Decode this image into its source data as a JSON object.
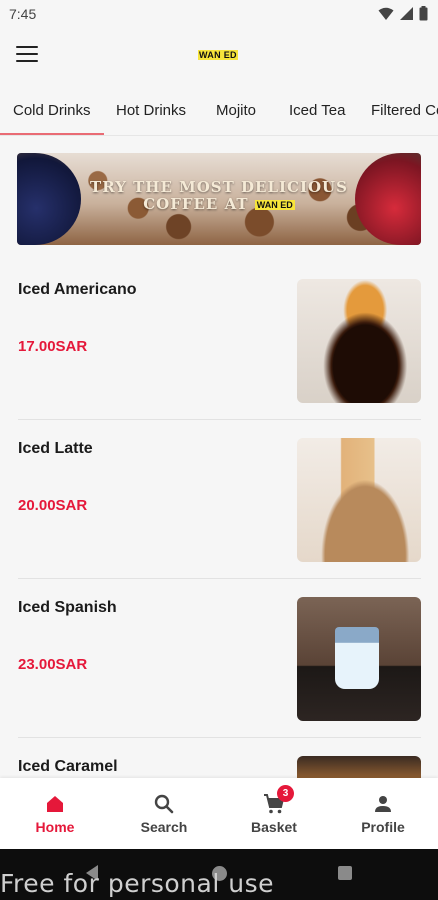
{
  "status": {
    "time": "7:45"
  },
  "header": {
    "logo_text": "WAN ED"
  },
  "tabs": [
    {
      "label": "Cold Drinks",
      "active": true
    },
    {
      "label": "Hot Drinks",
      "active": false
    },
    {
      "label": "Mojito",
      "active": false
    },
    {
      "label": "Iced Tea",
      "active": false
    },
    {
      "label": "Filtered Co",
      "active": false
    }
  ],
  "banner": {
    "line1": "TRY THE MOST DELICIOUS",
    "line2": "COFFEE AT",
    "logo_text": "WAN ED"
  },
  "products": [
    {
      "name": "Iced Americano",
      "price": "17.00SAR"
    },
    {
      "name": "Iced Latte",
      "price": "20.00SAR"
    },
    {
      "name": "Iced Spanish",
      "price": "23.00SAR"
    },
    {
      "name": "Iced Caramel",
      "price": ""
    }
  ],
  "bottom_nav": {
    "home": "Home",
    "search": "Search",
    "basket": "Basket",
    "basket_count": "3",
    "profile": "Profile"
  },
  "watermark": "Free for personal use",
  "colors": {
    "accent": "#e5183a",
    "tab_underline": "#e96b74",
    "logo_bg": "#f7e53b"
  }
}
